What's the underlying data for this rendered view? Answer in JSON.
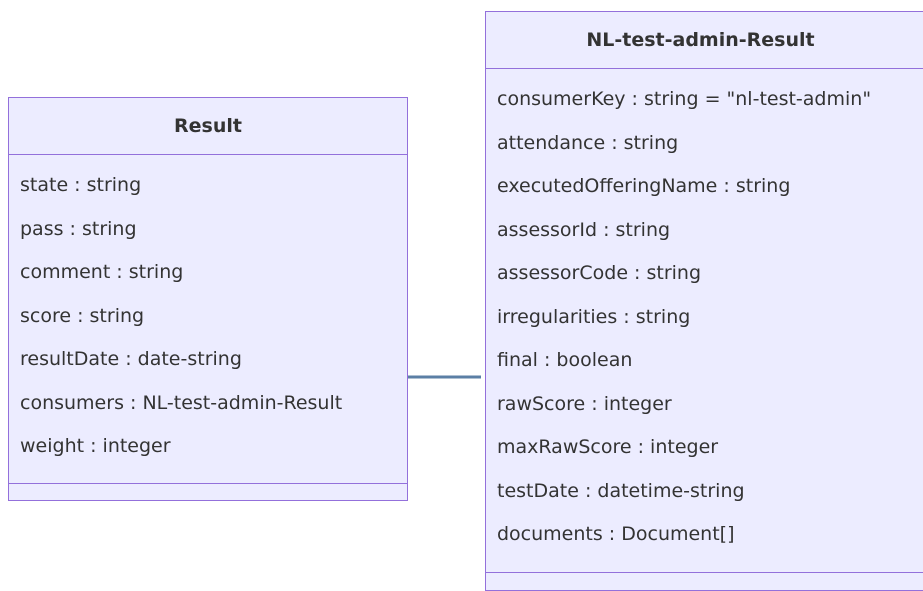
{
  "classes": [
    {
      "title": "Result",
      "attributes": [
        "state : string",
        "pass : string",
        "comment : string",
        "score : string",
        "resultDate : date-string",
        "consumers : NL-test-admin-Result",
        "weight : integer"
      ]
    },
    {
      "title": "NL-test-admin-Result",
      "attributes": [
        "consumerKey : string = \"nl-test-admin\"",
        "attendance : string",
        "executedOfferingName : string",
        "assessorId : string",
        "assessorCode : string",
        "irregularities : string",
        "final : boolean",
        "rawScore : integer",
        "maxRawScore : integer",
        "testDate : datetime-string",
        "documents : Document[]"
      ]
    }
  ],
  "colors": {
    "class_fill": "#ECECFF",
    "class_border": "#9370DB",
    "connector": "#5B7FA5",
    "text": "#333333"
  }
}
